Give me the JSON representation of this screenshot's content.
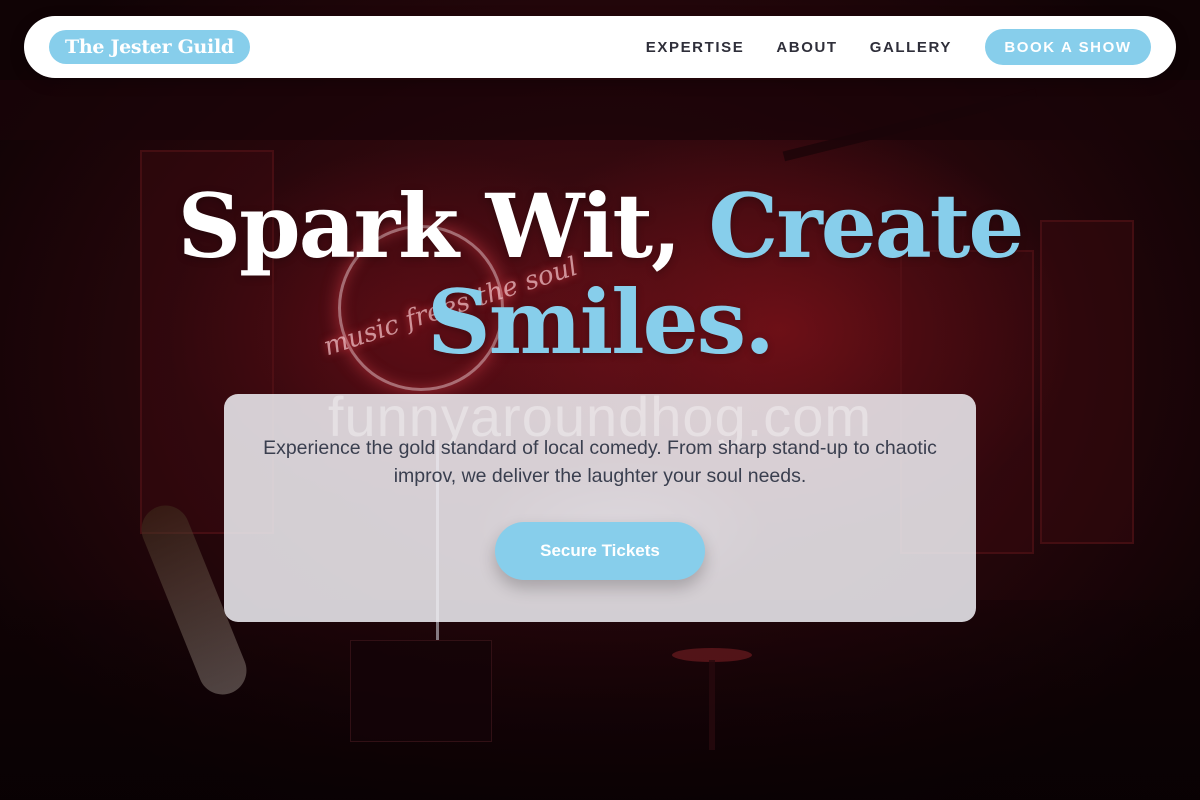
{
  "brand": {
    "name": "The Jester Guild"
  },
  "nav": {
    "links": [
      {
        "label": "EXPERTISE"
      },
      {
        "label": "ABOUT"
      },
      {
        "label": "GALLERY"
      }
    ],
    "cta_label": "BOOK A SHOW"
  },
  "hero": {
    "headline_part1": "Spark Wit,",
    "headline_part2": "Create Smiles.",
    "tagline": "Experience the gold standard of local comedy. From sharp stand-up to chaotic improv, we deliver the laughter your soul needs.",
    "cta_label": "Secure Tickets",
    "watermark": "funnyaroundhog.com"
  },
  "background": {
    "neon_sign_text": "music frees the soul"
  },
  "colors": {
    "accent": "#87ceeb",
    "nav_text": "#2f2f3a",
    "body_text": "#3a3f4f",
    "background_red": "#4a0d14"
  }
}
